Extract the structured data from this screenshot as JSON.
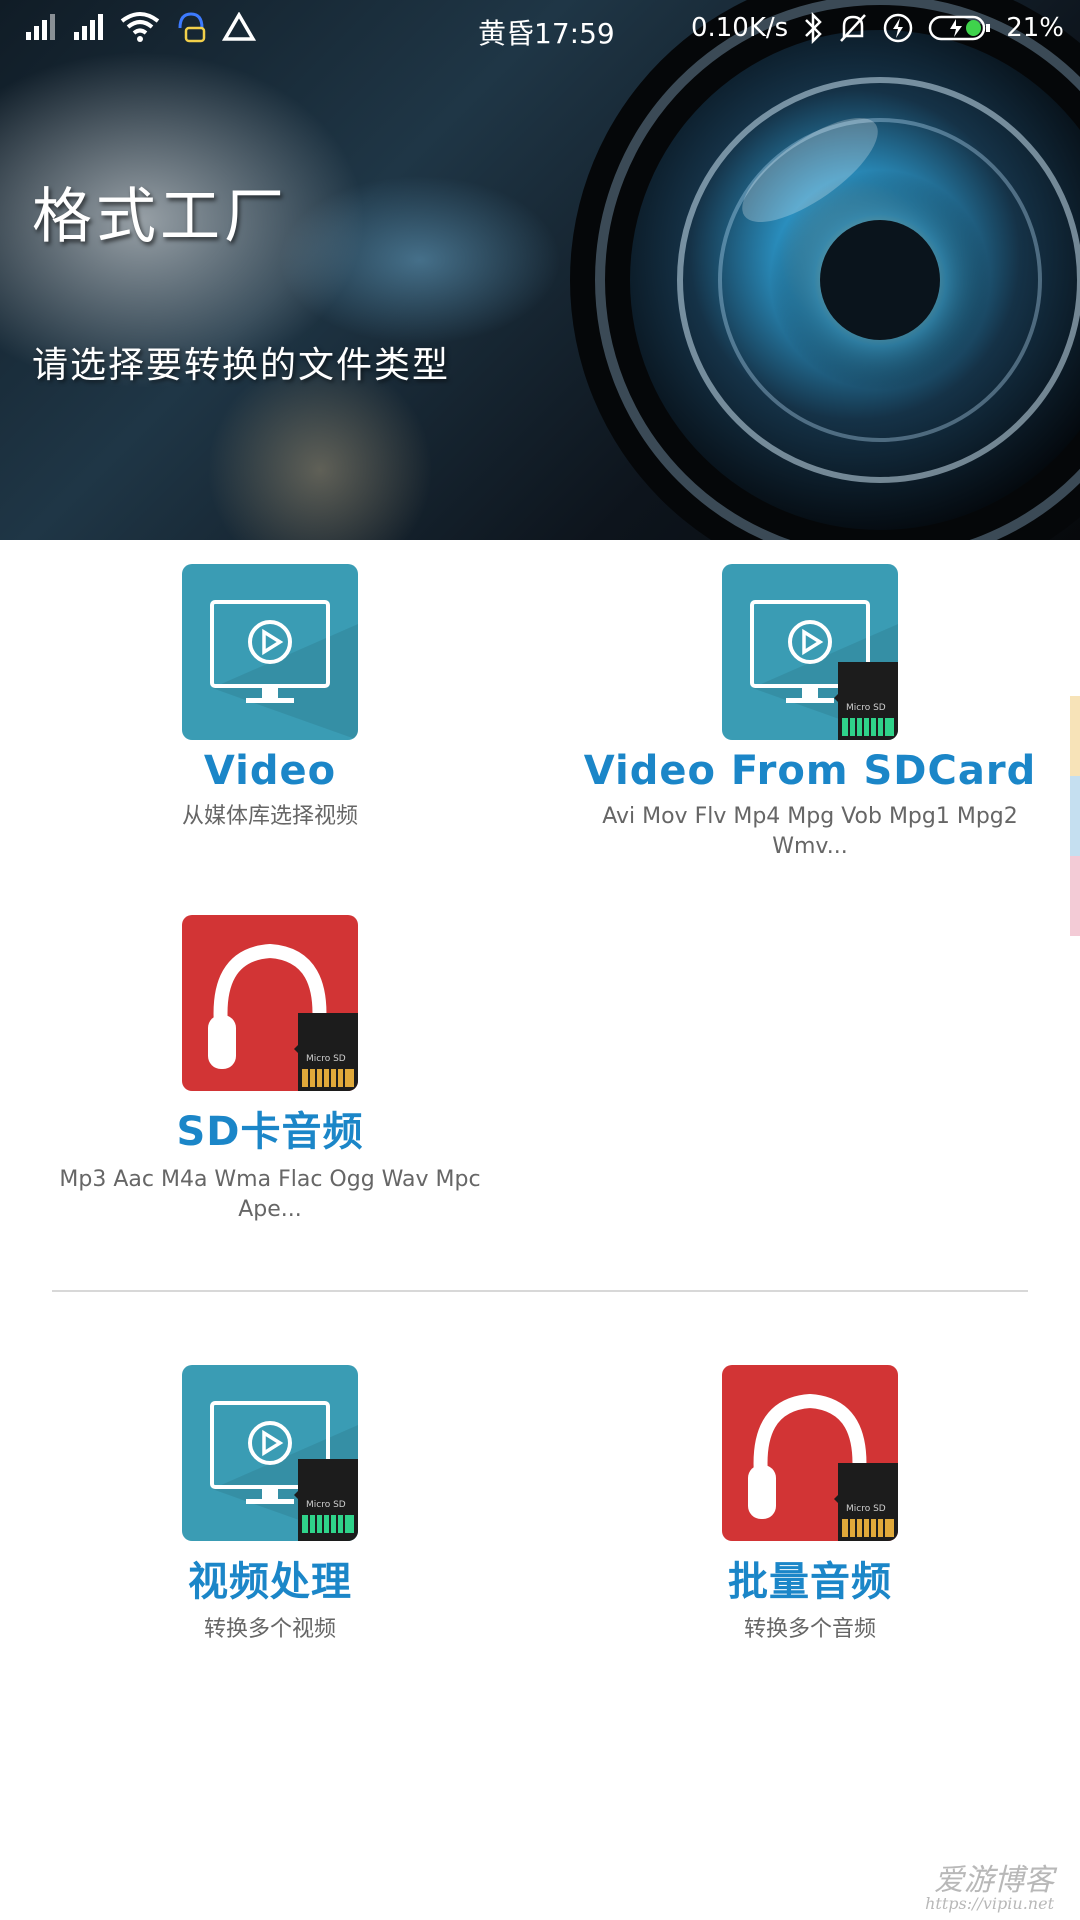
{
  "status_bar": {
    "time": "黄昏17:59",
    "net_speed": "0.10K/s",
    "battery": "21%"
  },
  "header": {
    "title": "格式工厂",
    "subtitle": "请选择要转换的文件类型"
  },
  "items": [
    {
      "title": "Video",
      "desc": "从媒体库选择视频",
      "icon": "video-monitor-icon"
    },
    {
      "title": "Video From SDCard",
      "desc": "Avi Mov Flv Mp4 Mpg Vob Mpg1 Mpg2 Wmv...",
      "icon": "video-sdcard-icon"
    },
    {
      "title": "SD卡音频",
      "desc": "Mp3 Aac M4a Wma Flac Ogg Wav Mpc Ape...",
      "icon": "headphones-sdcard-icon"
    }
  ],
  "batch": [
    {
      "title": "视频处理",
      "desc": "转换多个视频",
      "icon": "video-sdcard-icon"
    },
    {
      "title": "批量音频",
      "desc": "转换多个音频",
      "icon": "headphones-sdcard-icon"
    }
  ],
  "watermark": {
    "line1": "爱游博客",
    "line2": "https://vipiu.net"
  },
  "colors": {
    "title_blue": "#1b86c8",
    "tile_teal": "#3a9cb4",
    "tile_red": "#d23435",
    "sd_green": "#2fd38a",
    "sd_gold": "#e0a93a"
  }
}
